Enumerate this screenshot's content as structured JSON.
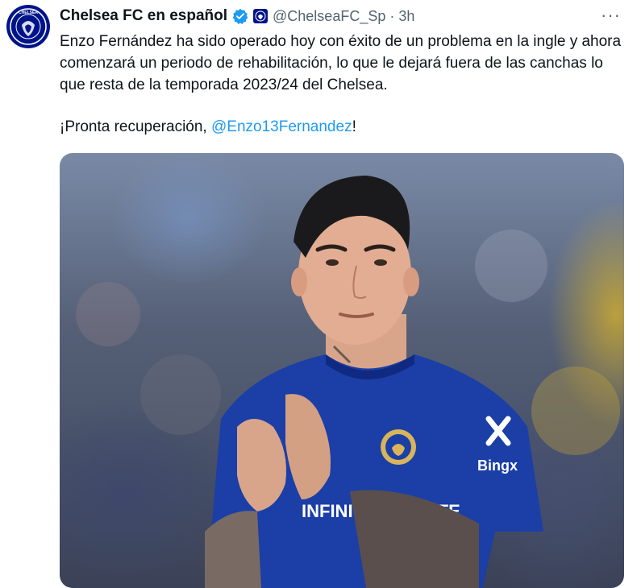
{
  "tweet": {
    "author_name": "Chelsea FC en español",
    "handle": "@ChelseaFC_Sp",
    "separator": "·",
    "time": "3h",
    "more_label": "···",
    "text_paragraph_1": "Enzo Fernández ha sido operado hoy con éxito de un problema en la ingle y ahora comenzará un periodo de rehabilitación, lo que le dejará fuera de las canchas lo que resta de la temporada 2023/24 del Chelsea.",
    "text_paragraph_2_prefix": "¡Pronta recuperación, ",
    "mention": "@Enzo13Fernandez",
    "text_paragraph_2_suffix": "!",
    "avatar_label": "CHELSEA",
    "media": {
      "shirt_sponsor": "INFINITE ATHLETE",
      "sleeve_sponsor": "Bingx"
    }
  },
  "colors": {
    "chelsea_blue": "#001489",
    "verified_blue": "#1d9bf0",
    "mention_blue": "#1d9bf0",
    "muted_text": "#536471"
  },
  "icons": {
    "verified": "verified-badge-icon",
    "org_badge": "chelsea-crest-icon",
    "more": "more-options-icon"
  }
}
